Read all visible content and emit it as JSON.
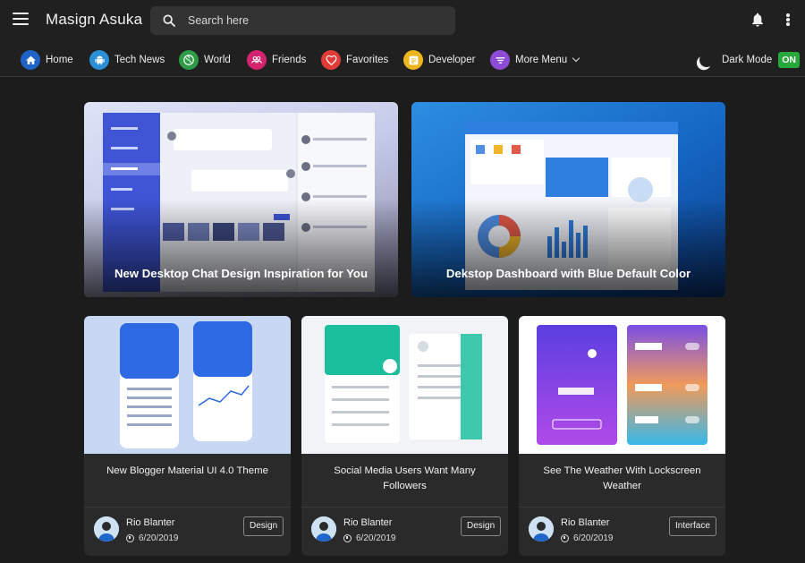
{
  "header": {
    "brand": "Masign Asuka",
    "search_placeholder": "Search here"
  },
  "nav": {
    "items": [
      {
        "label": "Home",
        "icon": "home-icon",
        "color": "#1e63c5"
      },
      {
        "label": "Tech News",
        "icon": "android-icon",
        "color": "#2a8fd6"
      },
      {
        "label": "World",
        "icon": "globe-icon",
        "color": "#2e9b46"
      },
      {
        "label": "Friends",
        "icon": "people-icon",
        "color": "#d4246f"
      },
      {
        "label": "Favorites",
        "icon": "heart-icon",
        "color": "#e03b36"
      },
      {
        "label": "Developer",
        "icon": "code-icon",
        "color": "#efb51c"
      },
      {
        "label": "More Menu",
        "icon": "filter-icon",
        "color": "#8e4bd6"
      }
    ],
    "dark_mode_label": "Dark Mode",
    "dark_mode_state": "ON"
  },
  "featured": [
    {
      "title": "New Desktop Chat Design Inspiration for You"
    },
    {
      "title": "Dekstop Dashboard with Blue Default Color"
    }
  ],
  "cards": [
    {
      "title": "New Blogger Material UI 4.0 Theme",
      "author": "Rio Blanter",
      "date": "6/20/2019",
      "tag": "Design"
    },
    {
      "title": "Social Media Users Want Many Followers",
      "author": "Rio Blanter",
      "date": "6/20/2019",
      "tag": "Design"
    },
    {
      "title": "See The Weather With Lockscreen Weather",
      "author": "Rio Blanter",
      "date": "6/20/2019",
      "tag": "Interface"
    }
  ],
  "colors": {
    "background": "#1c1c1c",
    "header": "#202020",
    "card": "#2a2a2a",
    "toggle_on": "#27a83a"
  }
}
